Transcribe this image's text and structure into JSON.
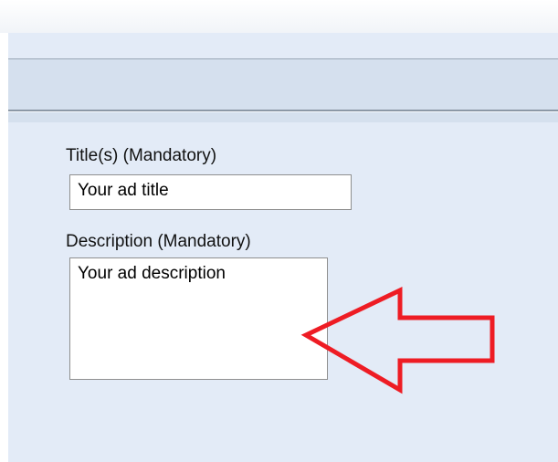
{
  "form": {
    "title_label": "Title(s) (Mandatory)",
    "title_value": "Your ad title",
    "description_label": "Description (Mandatory)",
    "description_value": "Your ad description"
  },
  "annotation": {
    "icon": "left-arrow-icon",
    "color": "#ee1c24"
  },
  "colors": {
    "panel_background": "#e3ebf7",
    "toolbar_background": "#d5e0ee",
    "divider": "#8c98a6"
  }
}
